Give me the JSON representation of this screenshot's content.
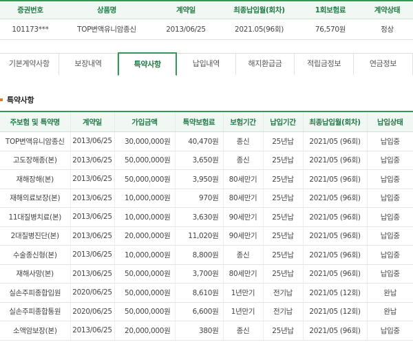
{
  "summary": {
    "headers": [
      "증권번호",
      "상품명",
      "계약일",
      "최종납입월(회차)",
      "1회보험료",
      "계약상태"
    ],
    "row": [
      "101173***",
      "TOP변액유니암종신",
      "2013/06/25",
      "2021.05(96회)",
      "76,570원",
      "정상"
    ]
  },
  "tabs": [
    {
      "label": "기본계약사항",
      "active": false
    },
    {
      "label": "보장내역",
      "active": false
    },
    {
      "label": "특약사항",
      "active": true
    },
    {
      "label": "납입내역",
      "active": false
    },
    {
      "label": "해지환급금",
      "active": false
    },
    {
      "label": "적립금정보",
      "active": false
    },
    {
      "label": "연금정보",
      "active": false
    }
  ],
  "section": {
    "title": "특약사항"
  },
  "riders": {
    "headers": [
      "주보험 및 특약명",
      "계약일",
      "가입금액",
      "특약보험료",
      "보험기간",
      "납입기간",
      "최종납입월(회차)",
      "납입상태"
    ],
    "rows": [
      [
        "TOP변액유니암종신",
        "2013/06/25",
        "30,000,000원",
        "40,470원",
        "종신",
        "25년납",
        "2021/05 (96회)",
        "납입중"
      ],
      [
        "고도장해종(본)",
        "2013/06/25",
        "50,000,000원",
        "3,650원",
        "종신",
        "25년납",
        "2021/05 (96회)",
        "납입중"
      ],
      [
        "재해장해(본)",
        "2013/06/25",
        "50,000,000원",
        "3,950원",
        "80세만기",
        "25년납",
        "2021/05 (96회)",
        "납입중"
      ],
      [
        "재해의료보장(본)",
        "2013/06/25",
        "10,000,000원",
        "970원",
        "80세만기",
        "25년납",
        "2021/05 (96회)",
        "납입중"
      ],
      [
        "11대질병치료(본)",
        "2013/06/25",
        "10,000,000원",
        "3,630원",
        "90세만기",
        "25년납",
        "2021/05 (96회)",
        "납입중"
      ],
      [
        "2대질병진단(본)",
        "2013/06/25",
        "20,000,000원",
        "11,020원",
        "90세만기",
        "25년납",
        "2021/05 (96회)",
        "납입중"
      ],
      [
        "수술종신형(본)",
        "2013/06/25",
        "10,000,000원",
        "8,800원",
        "종신",
        "25년납",
        "2021/05 (96회)",
        "납입중"
      ],
      [
        "재해사망(본)",
        "2013/06/25",
        "50,000,000원",
        "3,700원",
        "80세만기",
        "25년납",
        "2021/05 (96회)",
        "납입중"
      ],
      [
        "실손주피종합입원",
        "2020/06/25",
        "50,000,000원",
        "8,610원",
        "1년만기",
        "전기납",
        "2021/05 (12회)",
        "완납"
      ],
      [
        "실손주피종합통원",
        "2020/06/25",
        "50,000,000원",
        "6,600원",
        "1년만기",
        "전기납",
        "2021/05 (12회)",
        "완납"
      ],
      [
        "소액암보장(본)",
        "2013/06/25",
        "20,000,000원",
        "380원",
        "종신",
        "25년납",
        "2021/05 (96회)",
        "납입중"
      ]
    ]
  }
}
